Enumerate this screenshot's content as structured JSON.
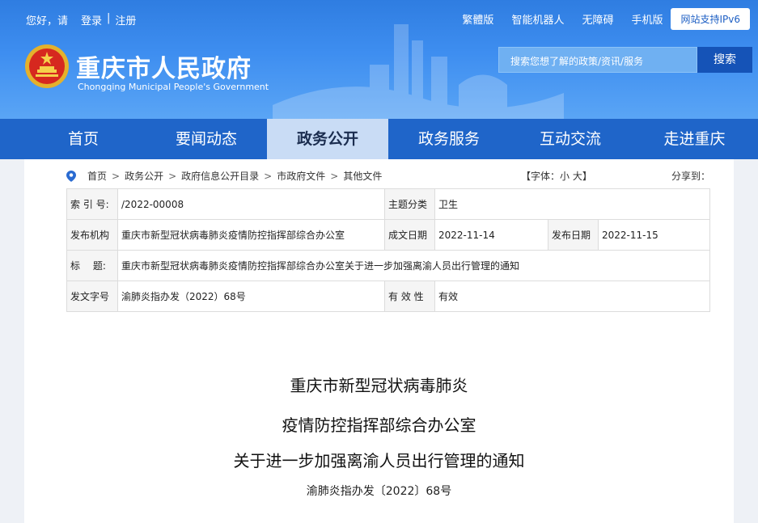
{
  "topbar": {
    "greeting": "您好，请",
    "login": "登录",
    "divider": "|",
    "register": "注册",
    "links": [
      "繁體版",
      "智能机器人",
      "无障碍",
      "手机版"
    ],
    "ipv6": "网站支持IPv6"
  },
  "site": {
    "title": "重庆市人民政府",
    "subtitle": "Chongqing Municipal People's Government"
  },
  "search": {
    "placeholder": "搜索您想了解的政策/资讯/服务",
    "button": "搜索"
  },
  "nav": [
    "首页",
    "要闻动态",
    "政务公开",
    "政务服务",
    "互动交流",
    "走进重庆"
  ],
  "breadcrumb": [
    "首页",
    "政务公开",
    "政府信息公开目录",
    "市政府文件",
    "其他文件"
  ],
  "font_control": "【字体：小 大】",
  "share": "分享到：",
  "meta": {
    "index_label": "索 引 号:",
    "index_value": "/2022-00008",
    "category_label": "主题分类",
    "category_value": "卫生",
    "issuer_label": "发布机构",
    "issuer_value": "重庆市新型冠状病毒肺炎疫情防控指挥部综合办公室",
    "created_label": "成文日期",
    "created_value": "2022-11-14",
    "published_label": "发布日期",
    "published_value": "2022-11-15",
    "title_label": "标　 题:",
    "title_value": "重庆市新型冠状病毒肺炎疫情防控指挥部综合办公室关于进一步加强离渝人员出行管理的通知",
    "docno_label": "发文字号",
    "docno_value": "渝肺炎指办发（2022）68号",
    "validity_label": "有 效 性",
    "validity_value": "有效"
  },
  "document": {
    "title_line1": "重庆市新型冠状病毒肺炎",
    "title_line2": "疫情防控指挥部综合办公室",
    "title_line3": "关于进一步加强离渝人员出行管理的通知",
    "number": "渝肺炎指办发〔2022〕68号"
  },
  "colors": {
    "header_blue": "#3e8ef0",
    "nav_blue": "#1f65c9",
    "nav_active": "#c9dcf5",
    "search_button": "#1553b7"
  }
}
